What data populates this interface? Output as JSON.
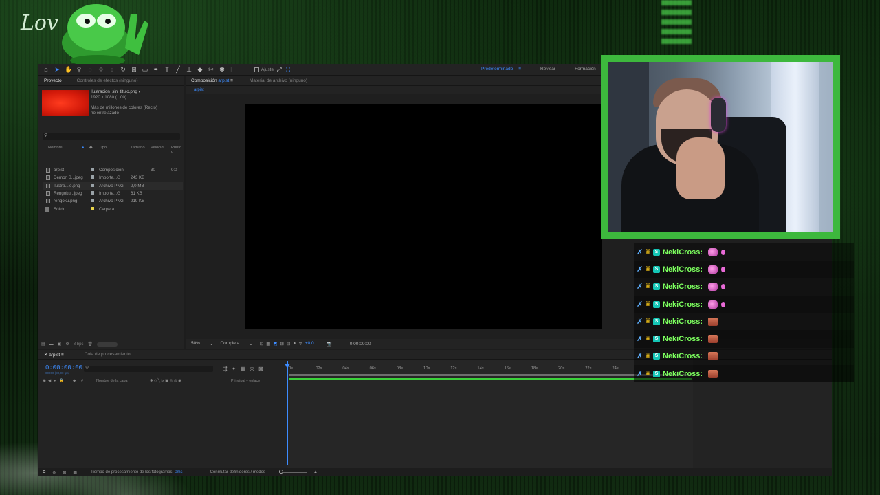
{
  "background": {
    "logo_text": "Lov"
  },
  "colors": {
    "accent": "#3d8cff",
    "frame_green": "#3db83d",
    "chat_name": "#7cff5e"
  },
  "toolbar": {
    "snap_label": "Ajuste",
    "workspaces": [
      "Predeterminado",
      "Revisar",
      "Formación"
    ]
  },
  "project": {
    "tabs": [
      "Proyecto",
      "Controles de efectos (ninguno)"
    ],
    "thumb": {
      "name": "ilustracion_sin_titulo.png ▾",
      "dims": "1920 x 1080 (1,00)",
      "colors": "Más de millones de colores (Recto)",
      "interlace": "no entrelazado"
    },
    "columns": [
      "Nombre",
      "Tipo",
      "Tamaño",
      "Velocid...",
      "Punto d"
    ],
    "rows": [
      {
        "name": "arpist",
        "type": "Composición",
        "size": "",
        "speed": "30",
        "point": "0:0",
        "swatch": "#9aa3a8",
        "kind": "comp"
      },
      {
        "name": "Demon S...jpeg",
        "type": "Importe...G",
        "size": "243 KB",
        "speed": "",
        "point": "",
        "swatch": "#9aa3a8",
        "kind": "file"
      },
      {
        "name": "ilustra...lo.png",
        "type": "Archivo PNG",
        "size": "2,0 MB",
        "speed": "",
        "point": "",
        "swatch": "#9aa3a8",
        "kind": "file"
      },
      {
        "name": "Rengoku...jpeg",
        "type": "Importe...G",
        "size": "61 KB",
        "speed": "",
        "point": "",
        "swatch": "#9aa3a8",
        "kind": "file"
      },
      {
        "name": "rengoku.png",
        "type": "Archivo PNG",
        "size": "919 KB",
        "speed": "",
        "point": "",
        "swatch": "#9aa3a8",
        "kind": "file"
      },
      {
        "name": "Sólido",
        "type": "Carpeta",
        "size": "",
        "speed": "",
        "point": "",
        "swatch": "#e8d44a",
        "kind": "folder"
      }
    ],
    "bpc": "8 bpc"
  },
  "composition": {
    "tab_prefix": "Composición",
    "tab_name": "arpist",
    "other_tab": "Material de archivo (ninguno)",
    "sub_tab": "arpist",
    "zoom": "50%",
    "resolution": "Completa",
    "exposure": "+0,0",
    "time": "0:00:00:00"
  },
  "timeline": {
    "tabs": [
      "arpist",
      "Cola de procesamiento"
    ],
    "timecode": "0:00:00:00",
    "timecode_sub": "00000 (30,00 fps)",
    "layer_header": {
      "name": "Nombre de la capa",
      "parent": "Principal y enlace"
    },
    "ruler": [
      "0s",
      "02s",
      "04s",
      "06s",
      "08s",
      "10s",
      "12s",
      "14s",
      "16s",
      "18s",
      "20s",
      "22s",
      "24s"
    ],
    "status_label": "Tiempo de procesamiento de los fotogramas:",
    "status_ms": "0ms",
    "modes_label": "Conmutar definidores / modos"
  },
  "chat": {
    "messages": [
      {
        "user": "NekiCross:",
        "emote": "pink"
      },
      {
        "user": "NekiCross:",
        "emote": "pink"
      },
      {
        "user": "NekiCross:",
        "emote": "pink"
      },
      {
        "user": "NekiCross:",
        "emote": "pink"
      },
      {
        "user": "NekiCross:",
        "emote": "face"
      },
      {
        "user": "NekiCross:",
        "emote": "face"
      },
      {
        "user": "NekiCross:",
        "emote": "face"
      },
      {
        "user": "NekiCross:",
        "emote": "face"
      }
    ]
  }
}
